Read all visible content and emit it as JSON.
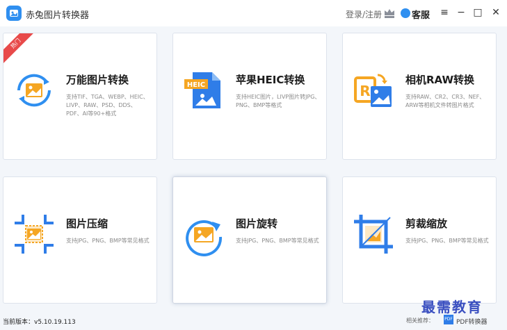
{
  "titlebar": {
    "app_title": "赤兔图片转换器",
    "login": "登录/注册",
    "service": "客服",
    "menu_icon": "≡",
    "minimize_icon": "−",
    "maximize_icon": "□",
    "close_icon": "✕"
  },
  "colors": {
    "accent_blue": "#2f8ff0",
    "accent_orange": "#f5a623",
    "hot_red": "#e84a4a",
    "watermark": "#3a4fc0"
  },
  "cards": [
    {
      "title": "万能图片转换",
      "desc": "支持TIF、TGA、WEBP、HEIC、LIVP、RAW、PSD、DDS、PDF、AI等90+格式",
      "icon": "refresh-image-icon",
      "badge": "热门"
    },
    {
      "title": "苹果HEIC转换",
      "desc": "支持HEIC图片，LIVP图片转JPG、PNG、BMP等格式",
      "icon": "heic-file-icon",
      "icon_text": "HEIC"
    },
    {
      "title": "相机RAW转换",
      "desc": "支持RAW、CR2、CR3、NEF、ARW等相机文件转图片格式",
      "icon": "raw-convert-icon",
      "icon_text": "R"
    },
    {
      "title": "图片压缩",
      "desc": "支持JPG、PNG、BMP等常见格式",
      "icon": "compress-image-icon"
    },
    {
      "title": "图片旋转",
      "desc": "支持JPG、PNG、BMP等常见格式",
      "icon": "rotate-image-icon"
    },
    {
      "title": "剪裁缩放",
      "desc": "支持JPG、PNG、BMP等常见格式",
      "icon": "crop-icon"
    }
  ],
  "status": {
    "version": "当前版本：v5.10.19.113",
    "related": "相关推荐：",
    "pdf_icon_text": "PDF",
    "pdf_link": "PDF转换器"
  },
  "watermark": "最需教育"
}
